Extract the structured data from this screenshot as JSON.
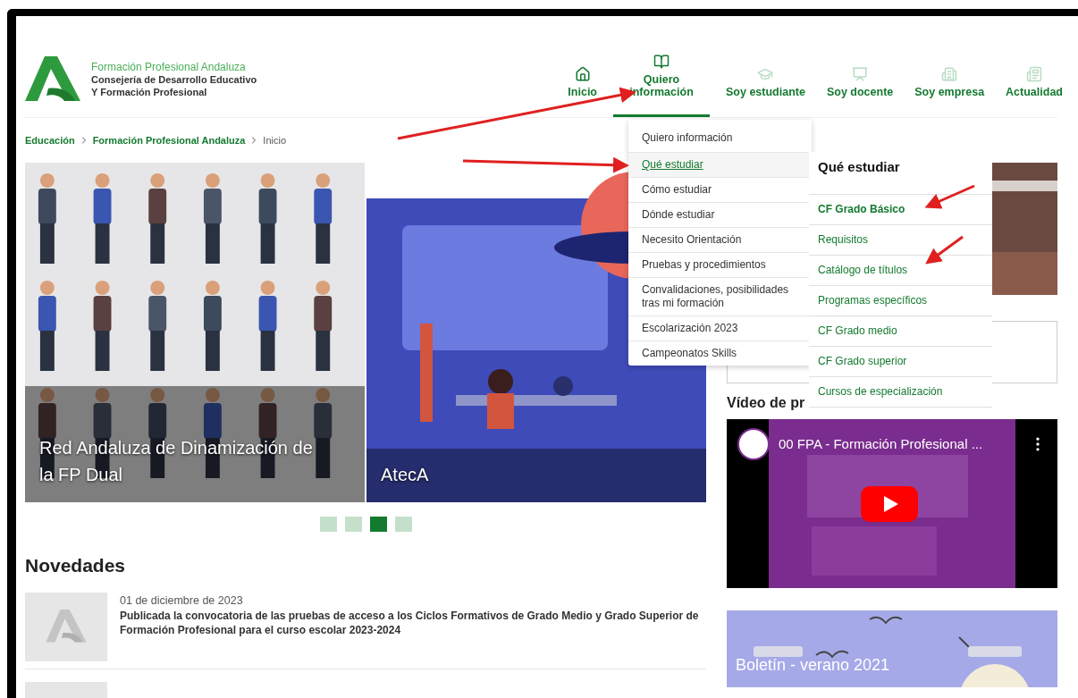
{
  "header": {
    "org": "Formación Profesional Andaluza",
    "department": [
      "Consejería de Desarrollo Educativo",
      "Y Formación Profesional"
    ],
    "nav": [
      {
        "label": "Inicio",
        "kind": "home",
        "selected": false
      },
      {
        "label": "Quiero información",
        "kind": "book",
        "selected": true
      },
      {
        "label": "Soy estudiante",
        "kind": "student",
        "selected": false
      },
      {
        "label": "Soy docente",
        "kind": "teacher",
        "selected": false
      },
      {
        "label": "Soy empresa",
        "kind": "company",
        "selected": false
      },
      {
        "label": "Actualidad",
        "kind": "news",
        "selected": false
      }
    ]
  },
  "breadcrumb": [
    {
      "label": "Educación",
      "current": false
    },
    {
      "label": "Formación Profesional Andaluza",
      "current": false
    },
    {
      "label": "Inicio",
      "current": true
    }
  ],
  "carousel": {
    "slides": [
      {
        "caption": "Red Andaluza de Dinamización de la FP Dual",
        "kind": "people"
      },
      {
        "caption": "AtecA",
        "kind": "science"
      }
    ],
    "dots": [
      {
        "selected": false
      },
      {
        "selected": false
      },
      {
        "selected": true
      },
      {
        "selected": false
      }
    ]
  },
  "news": {
    "title": "Novedades",
    "items": [
      {
        "date": "01 de diciembre de 2023",
        "title": "Publicada la convocatoria de las pruebas de acceso a los Ciclos Formativos de Grado Medio y Grado Superior de Formación Profesional para el curso escolar 2023-2024"
      }
    ]
  },
  "sidebar": {
    "video_heading": "Vídeo de pr",
    "video_title": "00 FPA - Formación Profesional ...",
    "bulletin_caption": "Boletín - verano 2021"
  },
  "dropdown": {
    "items": [
      {
        "label": "Quiero información",
        "selected": false
      },
      {
        "label": "Qué estudiar",
        "selected": true
      },
      {
        "label": "Cómo estudiar",
        "selected": false
      },
      {
        "label": "Dónde estudiar",
        "selected": false
      },
      {
        "label": "Necesito Orientación",
        "selected": false
      },
      {
        "label": "Pruebas y procedimientos",
        "selected": false
      },
      {
        "label": "Convalidaciones, posibilidades tras mi formación",
        "selected": false
      },
      {
        "label": "Escolarización 2023",
        "selected": false
      },
      {
        "label": "Campeonatos Skills",
        "selected": false
      }
    ]
  },
  "submenu": {
    "title": "Qué estudiar",
    "items": [
      {
        "label": "CF Grado Básico",
        "emphasized": true
      },
      {
        "label": "Requisitos",
        "emphasized": false
      },
      {
        "label": "Catálogo de títulos",
        "emphasized": false
      },
      {
        "label": "Programas específicos",
        "emphasized": false
      },
      {
        "label": "CF Grado medio",
        "emphasized": false
      },
      {
        "label": "CF Grado superior",
        "emphasized": false
      },
      {
        "label": "Cursos de especialización",
        "emphasized": false
      }
    ]
  }
}
